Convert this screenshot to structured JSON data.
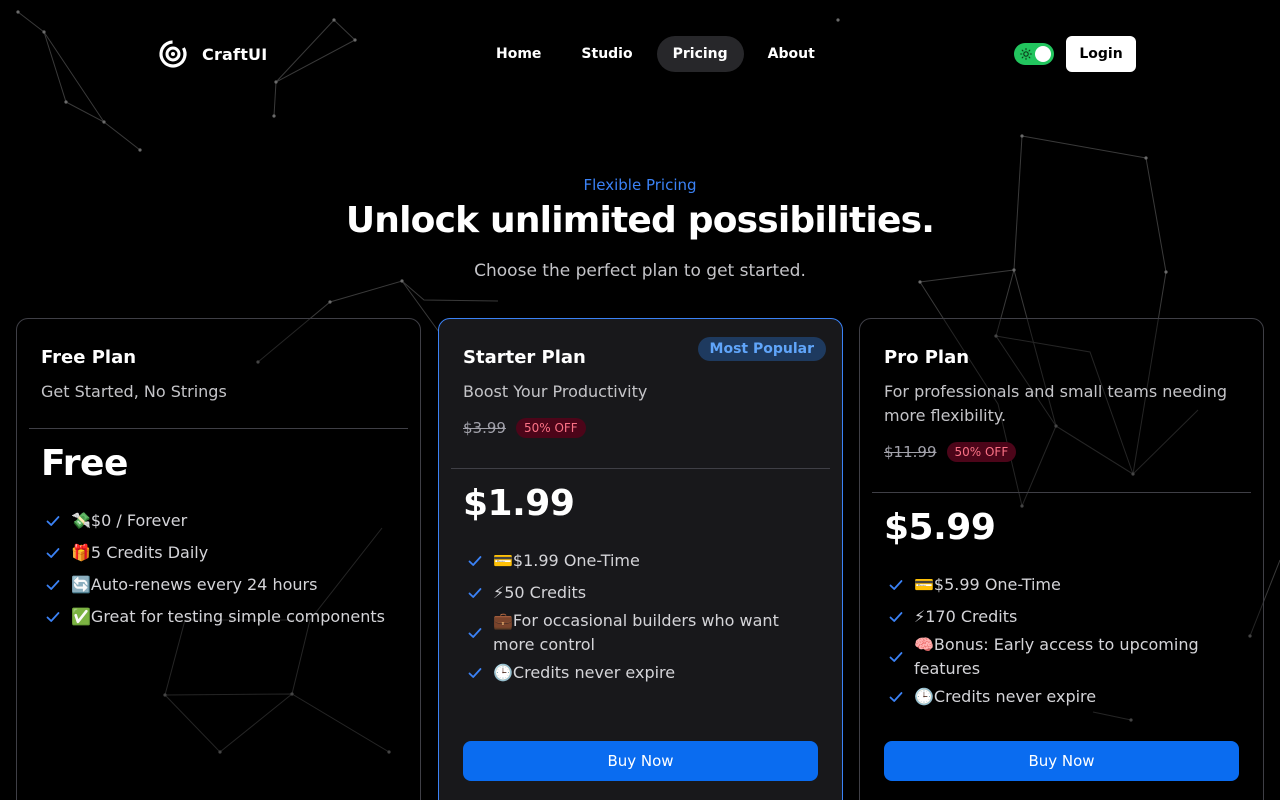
{
  "header": {
    "brand": "CraftUI",
    "nav": [
      {
        "label": "Home"
      },
      {
        "label": "Studio"
      },
      {
        "label": "Pricing",
        "active": true
      },
      {
        "label": "About"
      }
    ],
    "login_label": "Login",
    "theme_toggle_color": "#22c55e"
  },
  "hero": {
    "eyebrow": "Flexible Pricing",
    "title": "Unlock unlimited possibilities.",
    "subtitle": "Choose the perfect plan to get started."
  },
  "plans": [
    {
      "name": "Free Plan",
      "description": "Get Started, No Strings",
      "price": "Free",
      "features": [
        "💸$0 / Forever",
        "🎁5 Credits Daily",
        "🔄Auto-renews every 24 hours",
        "✅Great for testing simple components"
      ]
    },
    {
      "name": "Starter Plan",
      "badge": "Most Popular",
      "description": "Boost Your Productivity",
      "old_price": "$3.99",
      "discount": "50% OFF",
      "price": "$1.99",
      "features": [
        "💳$1.99 One-Time",
        "⚡50 Credits",
        "💼For occasional builders who want more control",
        "🕒Credits never expire"
      ],
      "cta": "Buy Now"
    },
    {
      "name": "Pro Plan",
      "description": "For professionals and small teams needing more flexibility.",
      "old_price": "$11.99",
      "discount": "50% OFF",
      "price": "$5.99",
      "features": [
        "💳$5.99 One-Time",
        "⚡170 Credits",
        "🧠Bonus: Early access to upcoming features",
        "🕒Credits never expire"
      ],
      "cta": "Buy Now"
    }
  ],
  "colors": {
    "accent": "#3b82f6",
    "button": "#0a6cf0",
    "discount_text": "#fb7185"
  }
}
